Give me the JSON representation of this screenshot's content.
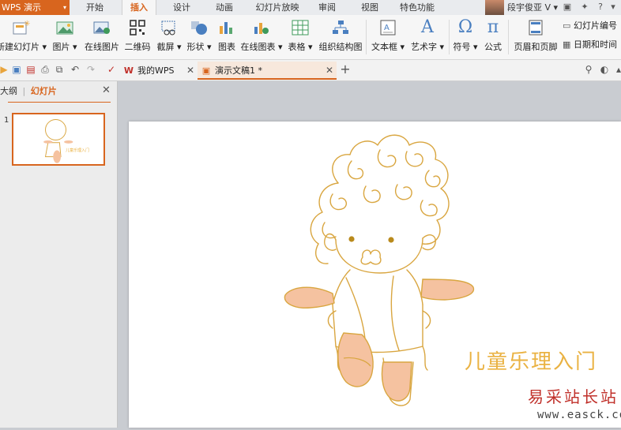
{
  "app": {
    "name": "WPS 演示"
  },
  "ribbon_tabs": [
    "开始",
    "插入",
    "设计",
    "动画",
    "幻灯片放映",
    "审阅",
    "视图",
    "特色功能"
  ],
  "active_tab": "插入",
  "user": {
    "name": "段宇俊亚"
  },
  "ribbon": {
    "new_slide": "新建幻灯片",
    "picture": "图片",
    "online_picture": "在线图片",
    "qrcode": "二维码",
    "screenshot": "截屏",
    "shape": "形状",
    "chart": "图表",
    "online_chart": "在线图表",
    "table": "表格",
    "org_chart": "组织结构图",
    "textbox": "文本框",
    "wordart": "艺术字",
    "symbol": "符号",
    "formula": "公式",
    "header_footer": "页眉和页脚",
    "slide_number": "幻灯片编号",
    "date_time": "日期和时间",
    "symbol_glyph": "Ω",
    "formula_glyph": "π"
  },
  "doc_tabs": [
    {
      "label": "我的WPS",
      "active": false
    },
    {
      "label": "演示文稿1 *",
      "active": true
    }
  ],
  "side_panel": {
    "tabs": [
      "大纲",
      "幻灯片"
    ],
    "active_tab": "幻灯片",
    "slide_number": "1"
  },
  "slide": {
    "title": "儿童乐理入门"
  },
  "watermark": {
    "text": "易采站长站",
    "url": "www.easck.com"
  },
  "colors": {
    "accent": "#d8651e",
    "title_text": "#eab242",
    "illustration_line": "#d9a640",
    "skin": "#f5c2a0"
  },
  "icons": [
    "new-slide-icon",
    "picture-icon",
    "online-picture-icon",
    "qrcode-icon",
    "screenshot-icon",
    "shape-icon",
    "chart-icon",
    "online-chart-icon",
    "table-icon",
    "org-chart-icon",
    "textbox-icon",
    "wordart-icon",
    "symbol-icon",
    "formula-icon",
    "header-footer-icon",
    "slide-number-icon",
    "date-time-icon"
  ]
}
